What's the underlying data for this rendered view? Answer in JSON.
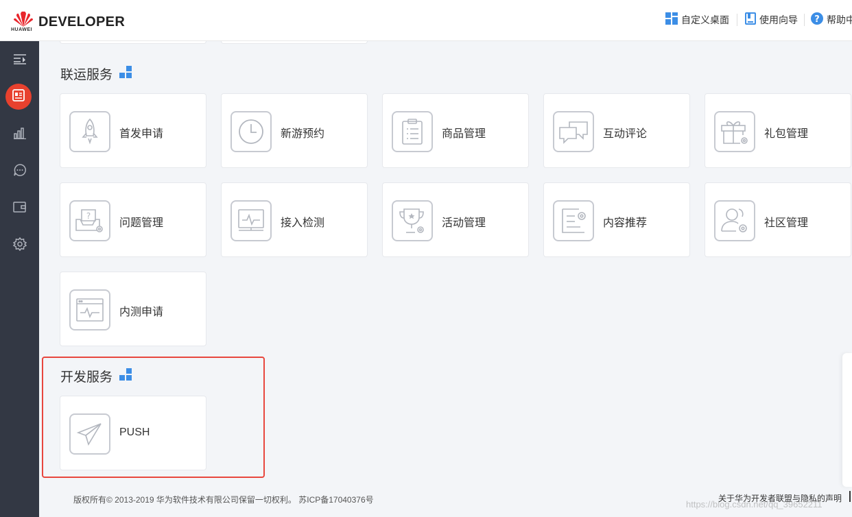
{
  "header": {
    "logo_text": "HUAWEI",
    "brand": "DEVELOPER",
    "nav": [
      {
        "label": "自定义桌面",
        "icon": "dashboard-icon"
      },
      {
        "label": "使用向导",
        "icon": "guide-icon"
      },
      {
        "label": "帮助中",
        "icon": "help-icon"
      }
    ]
  },
  "sidebar": {
    "items": [
      {
        "icon": "menu-collapse-icon"
      },
      {
        "icon": "app-card-icon",
        "active": true
      },
      {
        "icon": "bar-chart-icon"
      },
      {
        "icon": "chat-bubble-icon"
      },
      {
        "icon": "wallet-icon"
      },
      {
        "icon": "settings-icon"
      }
    ]
  },
  "sections": [
    {
      "title": "联运服务",
      "cards": [
        {
          "label": "首发申请",
          "icon": "rocket-icon"
        },
        {
          "label": "新游预约",
          "icon": "clock-icon"
        },
        {
          "label": "商品管理",
          "icon": "clipboard-icon"
        },
        {
          "label": "互动评论",
          "icon": "comments-icon"
        },
        {
          "label": "礼包管理",
          "icon": "gift-icon"
        },
        {
          "label": "问题管理",
          "icon": "question-tray-icon"
        },
        {
          "label": "接入检测",
          "icon": "monitor-pulse-icon"
        },
        {
          "label": "活动管理",
          "icon": "trophy-icon"
        },
        {
          "label": "内容推荐",
          "icon": "document-settings-icon"
        },
        {
          "label": "社区管理",
          "icon": "community-icon"
        },
        {
          "label": "内测申请",
          "icon": "browser-pulse-icon"
        }
      ]
    },
    {
      "title": "开发服务",
      "cards": [
        {
          "label": "PUSH",
          "icon": "paper-plane-icon"
        }
      ]
    }
  ],
  "footer": {
    "copyright": "版权所有© 2013-2019 华为软件技术有限公司保留一切权利。 苏ICP备17040376号",
    "privacy_link": "关于华为开发者联盟与隐私的声明",
    "watermark": "https://blog.csdn.net/qq_39652211"
  },
  "colors": {
    "accent": "#e8412e",
    "sidebar_bg": "#333844",
    "page_bg": "#f3f5f8",
    "grid_icon": "#3c8ee6",
    "highlight_border": "#e8463d"
  }
}
